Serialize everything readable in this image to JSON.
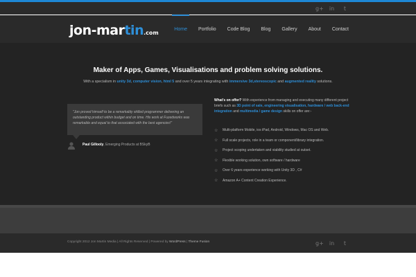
{
  "social": {
    "icons": [
      "google-plus-icon",
      "linkedin-icon",
      "twitter-icon"
    ],
    "glyphs": [
      "g+",
      "in",
      "t"
    ]
  },
  "logo": {
    "text_a": "jon-mar",
    "text_b": "tin",
    "text_c": ".com"
  },
  "nav": {
    "items": [
      "Home",
      "Portfolio",
      "Code Blog",
      "Blog",
      "Gallery",
      "About",
      "Contact"
    ],
    "active": "Home"
  },
  "hero": {
    "title": "Maker of Apps, Games, Visualisations and problem solving solutions.",
    "sub": {
      "p1": "With a specialism in ",
      "h1": "unity 3d",
      "p2": ", ",
      "h2": "computer vision",
      "p3": ", ",
      "h3": "html 5",
      "p4": " and over 5 years integrating with ",
      "h4": "immersive 3d,stereoscopic",
      "p5": " and ",
      "h5": "augmented reality",
      "p6": " solutions."
    }
  },
  "testimonial": {
    "quote": "\"Jon proved himself to be a remarkably skilled programmer delivering an outstanding product within budget and on time. His work at Fuzedworks was remarkable and equal to that associated with the best agencies!\"",
    "name": "Paul Gillooly",
    "role": ", Emerging Products at BSkyB"
  },
  "offer": {
    "lead": "What's on offer?",
    "p1": " With experience from managing and executing many different project briefs such as ",
    "h1": "3D point of sale, engineering visualisation, hardware / web back-end integration",
    "p2": " and ",
    "h2": "multimedia / game design",
    "p3": " skills on offer are:-",
    "items": [
      "Multi-platform Mobile, ios iPad, Android, Windows, Mac OS and Web.",
      "Full scale projects, role in a team or component/library integration.",
      "Project scoping undertaken and viability studied at outset.",
      "Flexible working solution, own software / hardware",
      "Over 6 years experience working with Unity 3D , C#",
      "Amazon A+ Content Creation Experience."
    ]
  },
  "footer": {
    "copyright": "Copyright 2012 Jon Martin Media | All Rights Reserved | Powered by ",
    "wp": "WordPress",
    "sep": " | ",
    "theme": "Theme Fusion"
  },
  "colors": {
    "accent": "#2e8fd8",
    "topline": "#1e88d6"
  }
}
